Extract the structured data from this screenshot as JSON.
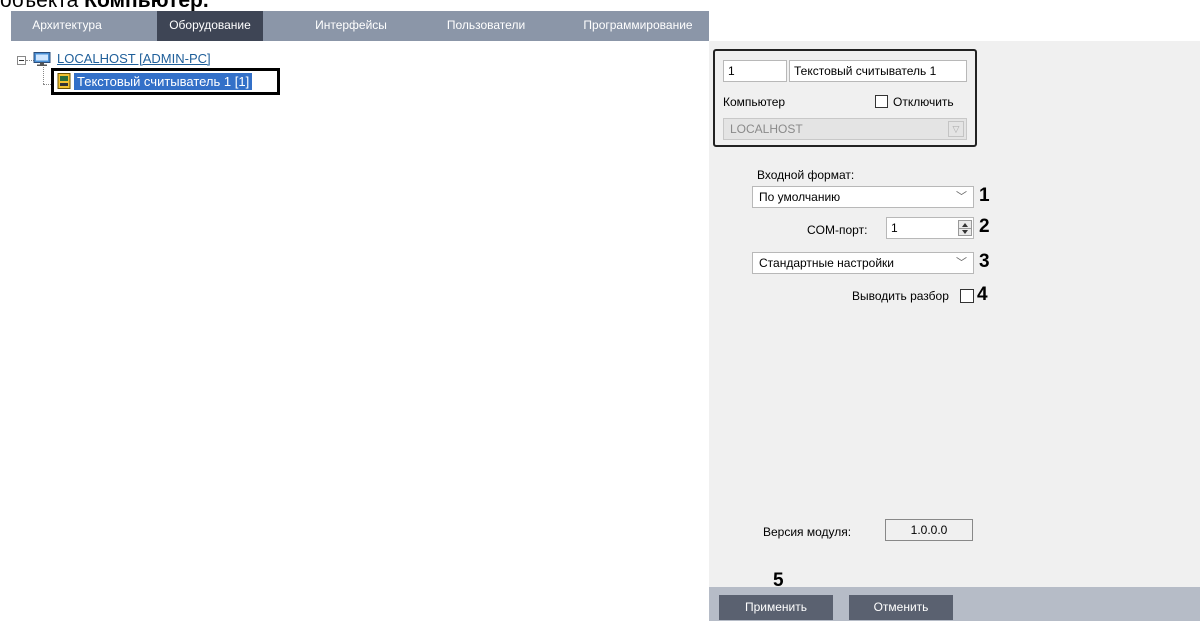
{
  "cropped_heading": {
    "prefix": "объекта ",
    "bold": "Компьютер."
  },
  "tabs": [
    "Архитектура",
    "Оборудование",
    "Интерфейсы",
    "Пользователи",
    "Программирование"
  ],
  "tree": {
    "root_label": "LOCALHOST [ADMIN-PC]",
    "child_label": "Текстовый считыватель 1 [1]"
  },
  "device": {
    "id": "1",
    "name": "Текстовый считыватель 1",
    "computer_label": "Компьютер",
    "disable_label": "Отключить",
    "computer_value": "LOCALHOST"
  },
  "settings": {
    "input_format_label": "Входной формат:",
    "input_format_value": "По умолчанию",
    "com_port_label": "COM-порт:",
    "com_port_value": "1",
    "preset_value": "Стандартные настройки",
    "parse_label": "Выводить разбор"
  },
  "callouts": [
    "1",
    "2",
    "3",
    "4",
    "5"
  ],
  "module": {
    "version_label": "Версия модуля:",
    "version_value": "1.0.0.0"
  },
  "buttons": {
    "apply": "Применить",
    "cancel": "Отменить"
  }
}
